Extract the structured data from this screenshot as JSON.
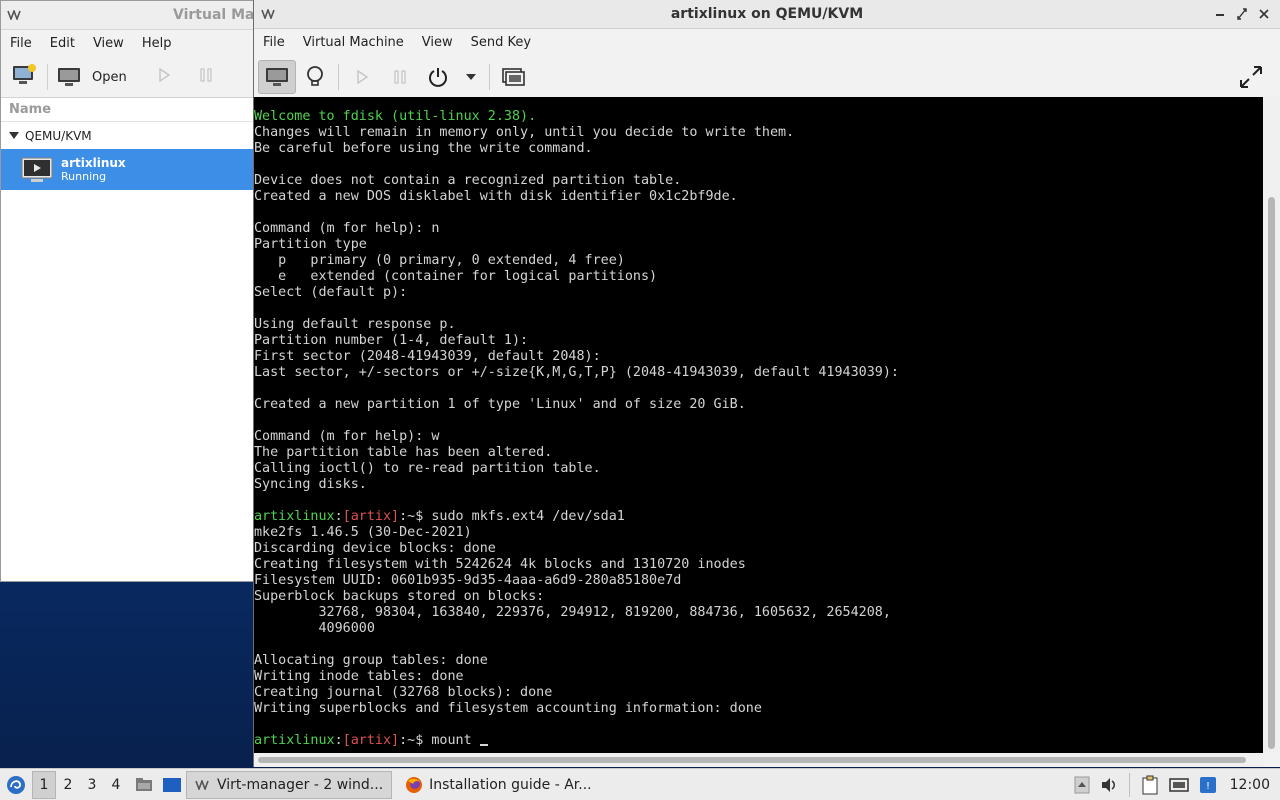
{
  "vmm": {
    "title": "Virtual Ma",
    "menu": [
      "File",
      "Edit",
      "View",
      "Help"
    ],
    "toolbar": {
      "open_label": "Open"
    },
    "column_header": "Name",
    "group": "QEMU/KVM",
    "vm": {
      "name": "artixlinux",
      "status": "Running"
    }
  },
  "console": {
    "title": "artixlinux on QEMU/KVM",
    "menu": [
      "File",
      "Virtual Machine",
      "View",
      "Send Key"
    ]
  },
  "terminal": {
    "lines": [
      "Welcome to fdisk (util-linux 2.38).",
      "Changes will remain in memory only, until you decide to write them.",
      "Be careful before using the write command.",
      "",
      "Device does not contain a recognized partition table.",
      "Created a new DOS disklabel with disk identifier 0x1c2bf9de.",
      "",
      "Command (m for help): n",
      "Partition type",
      "   p   primary (0 primary, 0 extended, 4 free)",
      "   e   extended (container for logical partitions)",
      "Select (default p):",
      "",
      "Using default response p.",
      "Partition number (1-4, default 1):",
      "First sector (2048-41943039, default 2048):",
      "Last sector, +/-sectors or +/-size{K,M,G,T,P} (2048-41943039, default 41943039):",
      "",
      "Created a new partition 1 of type 'Linux' and of size 20 GiB.",
      "",
      "Command (m for help): w",
      "The partition table has been altered.",
      "Calling ioctl() to re-read partition table.",
      "Syncing disks.",
      "",
      "",
      "mke2fs 1.46.5 (30-Dec-2021)",
      "Discarding device blocks: done",
      "Creating filesystem with 5242624 4k blocks and 1310720 inodes",
      "Filesystem UUID: 0601b935-9d35-4aaa-a6d9-280a85180e7d",
      "Superblock backups stored on blocks:",
      "        32768, 98304, 163840, 229376, 294912, 819200, 884736, 1605632, 2654208,",
      "        4096000",
      "",
      "Allocating group tables: done",
      "Writing inode tables: done",
      "Creating journal (32768 blocks): done",
      "Writing superblocks and filesystem accounting information: done",
      ""
    ],
    "prompt_host": "artixlinux",
    "prompt_colon": ":",
    "prompt_dir": "[artix]",
    "prompt_tail": ":~$ ",
    "command1": "sudo mkfs.ext4 /dev/sda1",
    "command2": "mount "
  },
  "taskbar": {
    "workspaces": [
      "1",
      "2",
      "3",
      "4"
    ],
    "tasks": [
      {
        "label": "Virt-manager - 2 wind...",
        "active": true
      },
      {
        "label": "Installation guide - Ar...",
        "active": false
      }
    ],
    "clock": "12:00"
  },
  "colors": {
    "selection": "#3d8ee6",
    "terminal_bg": "#000000",
    "terminal_green": "#4fd14f",
    "terminal_red": "#d9534f",
    "desktop": "#0b2f6e"
  }
}
